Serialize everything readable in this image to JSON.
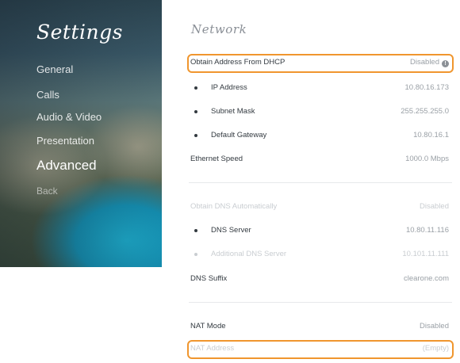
{
  "sidebar": {
    "title": "Settings",
    "items": [
      {
        "label": "General"
      },
      {
        "label": "Calls"
      },
      {
        "label": "Audio & Video"
      },
      {
        "label": "Presentation"
      },
      {
        "label": "Advanced"
      },
      {
        "label": "Back"
      }
    ]
  },
  "main": {
    "title": "Network",
    "rows": [
      {
        "label": "Obtain Address From DHCP",
        "value": "Disabled"
      },
      {
        "label": "IP Address",
        "value": "10.80.16.173"
      },
      {
        "label": "Subnet Mask",
        "value": "255.255.255.0"
      },
      {
        "label": "Default Gateway",
        "value": "10.80.16.1"
      },
      {
        "label": "Ethernet Speed",
        "value": "1000.0 Mbps"
      },
      {
        "label": "Obtain DNS Automatically",
        "value": "Disabled"
      },
      {
        "label": "DNS Server",
        "value": "10.80.11.116"
      },
      {
        "label": "Additional DNS Server",
        "value": "10.101.11.111"
      },
      {
        "label": "DNS Suffix",
        "value": "clearone.com"
      },
      {
        "label": "NAT Mode",
        "value": "Disabled"
      },
      {
        "label": "NAT Address",
        "value": "(Empty)"
      }
    ]
  },
  "colors": {
    "highlight": "#f0962e",
    "label": "#333a40",
    "value": "#9aa0a6",
    "faded": "#c9cdd1"
  },
  "icons": {
    "dhcp_info": "info-icon"
  }
}
